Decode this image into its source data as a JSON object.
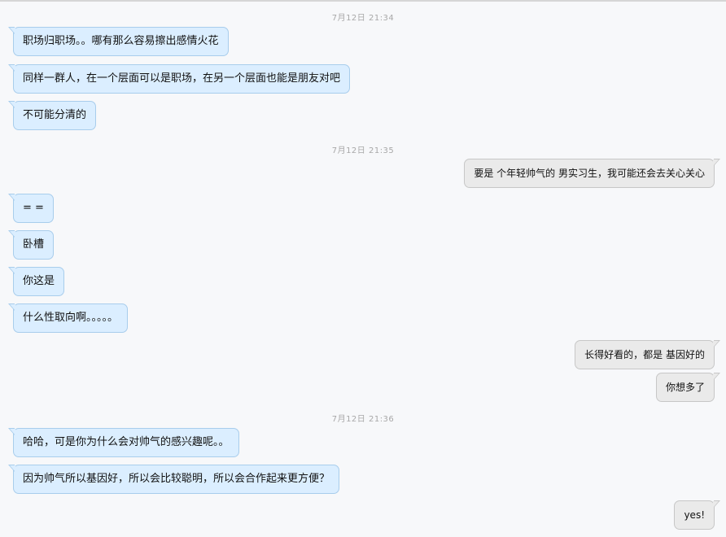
{
  "conversation": {
    "timestamps": [
      "7月12日  21:34",
      "7月12日  21:35",
      "7月12日  21:36"
    ],
    "messages": [
      {
        "side": "in",
        "text": "职场归职场。。哪有那么容易擦出感情火花"
      },
      {
        "side": "in",
        "text": "同样一群人，在一个层面可以是职场，在另一个层面也能是朋友对吧"
      },
      {
        "side": "in",
        "text": "不可能分清的"
      },
      {
        "side": "out",
        "text": "要是 个年轻帅气的 男实习生，我可能还会去关心关心"
      },
      {
        "side": "in",
        "text": "= ="
      },
      {
        "side": "in",
        "text": "卧槽"
      },
      {
        "side": "in",
        "text": "你这是"
      },
      {
        "side": "in",
        "text": "什么性取向啊。。。。。"
      },
      {
        "side": "out",
        "text": "长得好看的，都是 基因好的"
      },
      {
        "side": "out",
        "text": "你想多了"
      },
      {
        "side": "in",
        "text": "哈哈，可是你为什么会对帅气的感兴趣呢。。"
      },
      {
        "side": "in",
        "text": "因为帅气所以基因好，所以会比较聪明，所以会合作起来更方便？"
      },
      {
        "side": "out",
        "text": "yes!"
      }
    ]
  },
  "colors": {
    "background": "#f7f8fa",
    "incoming_bubble": "#dbeeff",
    "incoming_border": "#a8cdec",
    "outgoing_bubble": "#eaeaea",
    "outgoing_border": "#c7c7c7",
    "timestamp_text": "#a8a8a8"
  }
}
